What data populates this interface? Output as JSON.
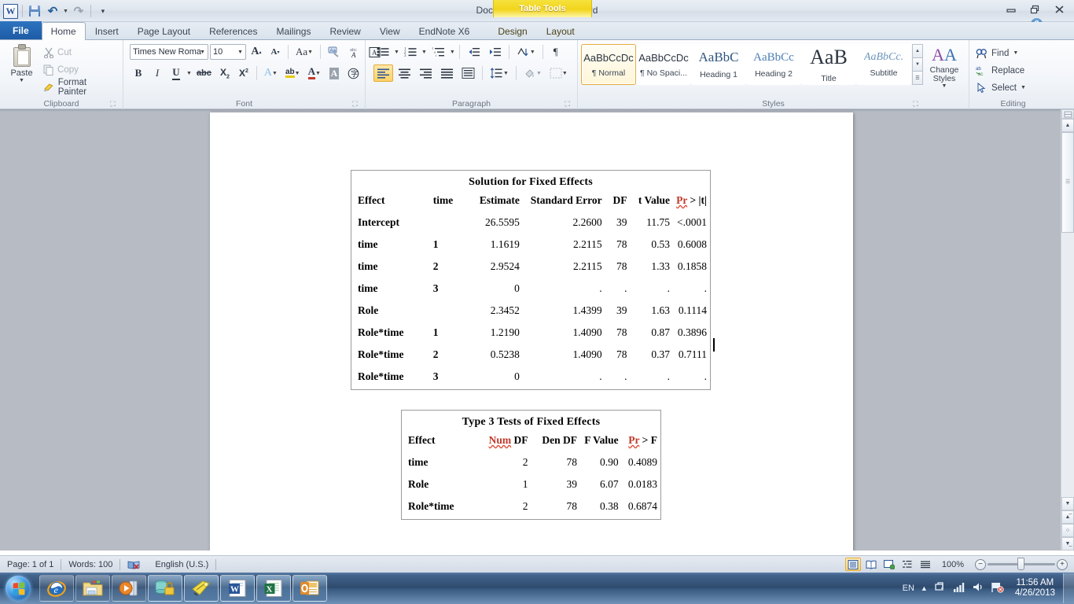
{
  "window": {
    "title": "Document7  -  Microsoft Word",
    "contextual_banner": "Table Tools",
    "minimize": "Minimize",
    "restore": "Restore Down",
    "close": "Close",
    "help": "?",
    "collapse_ribbon": "Minimize the Ribbon"
  },
  "quick_access": {
    "save": "Save",
    "undo": "Undo",
    "redo": "Redo",
    "customize": "Customize Quick Access Toolbar"
  },
  "tabs": [
    {
      "label": "File",
      "type": "file"
    },
    {
      "label": "Home",
      "type": "active"
    },
    {
      "label": "Insert",
      "type": "normal"
    },
    {
      "label": "Page Layout",
      "type": "normal"
    },
    {
      "label": "References",
      "type": "normal"
    },
    {
      "label": "Mailings",
      "type": "normal"
    },
    {
      "label": "Review",
      "type": "normal"
    },
    {
      "label": "View",
      "type": "normal"
    },
    {
      "label": "EndNote X6",
      "type": "normal"
    },
    {
      "label": "Design",
      "type": "contextual"
    },
    {
      "label": "Layout",
      "type": "contextual"
    }
  ],
  "ribbon": {
    "clipboard": {
      "label": "Clipboard",
      "paste": "Paste",
      "cut": "Cut",
      "copy": "Copy",
      "format_painter": "Format Painter",
      "launcher": "Clipboard dialog launcher"
    },
    "font": {
      "label": "Font",
      "font_name": "Times New Roma",
      "font_size": "10",
      "grow_font": "A",
      "shrink_font": "A",
      "change_case": "Aa",
      "clear_formatting": "Clear Formatting",
      "bold": "B",
      "italic": "I",
      "underline": "U",
      "strikethrough": "abc",
      "subscript": "X2",
      "superscript": "X2",
      "text_effects": "A",
      "highlight": "ab",
      "font_color": "A",
      "char_shading": "A",
      "char_border": "A",
      "launcher": "Font dialog launcher"
    },
    "paragraph": {
      "label": "Paragraph",
      "bullets": "Bullets",
      "numbering": "Numbering",
      "multilevel": "Multilevel List",
      "decrease_indent": "Decrease Indent",
      "increase_indent": "Increase Indent",
      "sort": "Sort",
      "show_marks": "¶",
      "align_left": "Align Text Left",
      "align_center": "Center",
      "align_right": "Align Text Right",
      "justify": "Justify",
      "distribute": "Distributed",
      "line_spacing": "Line and Paragraph Spacing",
      "shading": "Shading",
      "borders": "Borders",
      "launcher": "Paragraph dialog launcher"
    },
    "styles": {
      "label": "Styles",
      "launcher": "Styles dialog launcher",
      "items": [
        {
          "preview": "AaBbCcDc",
          "name": "¶ Normal",
          "selected": true
        },
        {
          "preview": "AaBbCcDc",
          "name": "¶ No Spaci...",
          "selected": false
        },
        {
          "preview": "AaBbC",
          "name": "Heading 1",
          "selected": false
        },
        {
          "preview": "AaBbCc",
          "name": "Heading 2",
          "selected": false
        },
        {
          "preview": "AaB",
          "name": "Title",
          "selected": false
        },
        {
          "preview": "AaBbCc.",
          "name": "Subtitle",
          "selected": false
        }
      ],
      "scroll_up": "▲",
      "scroll_down": "▼",
      "more": "▬",
      "change_styles": "Change Styles"
    },
    "editing": {
      "label": "Editing",
      "find": "Find",
      "replace": "Replace",
      "select": "Select"
    }
  },
  "document": {
    "tables": [
      {
        "id": "solution-fixed-effects",
        "caption": "Solution for Fixed Effects",
        "columns": [
          "Effect",
          "time",
          "Estimate",
          "Standard Error",
          "DF",
          "t Value",
          "Pr > |t|"
        ],
        "rows": [
          [
            "Intercept",
            "",
            "26.5595",
            "2.2600",
            "39",
            "11.75",
            "<.0001"
          ],
          [
            "time",
            "1",
            "1.1619",
            "2.2115",
            "78",
            "0.53",
            "0.6008"
          ],
          [
            "time",
            "2",
            "2.9524",
            "2.2115",
            "78",
            "1.33",
            "0.1858"
          ],
          [
            "time",
            "3",
            "0",
            ".",
            ".",
            ".",
            "."
          ],
          [
            "Role",
            "",
            "2.3452",
            "1.4399",
            "39",
            "1.63",
            "0.1114"
          ],
          [
            "Role*time",
            "1",
            "1.2190",
            "1.4090",
            "78",
            "0.87",
            "0.3896"
          ],
          [
            "Role*time",
            "2",
            "0.5238",
            "1.4090",
            "78",
            "0.37",
            "0.7111"
          ],
          [
            "Role*time",
            "3",
            "0",
            ".",
            ".",
            ".",
            "."
          ]
        ]
      },
      {
        "id": "type3-tests-fixed-effects",
        "caption": "Type 3 Tests of Fixed Effects",
        "columns": [
          "Effect",
          "Num DF",
          "Den DF",
          "F Value",
          "Pr > F"
        ],
        "rows": [
          [
            "time",
            "2",
            "78",
            "0.90",
            "0.4089"
          ],
          [
            "Role",
            "1",
            "39",
            "6.07",
            "0.0183"
          ],
          [
            "Role*time",
            "2",
            "78",
            "0.38",
            "0.6874"
          ]
        ]
      }
    ]
  },
  "status_bar": {
    "page": "Page: 1 of 1",
    "words": "Words: 100",
    "proofing": "Proofing errors",
    "language": "English (U.S.)",
    "views": [
      "Print Layout",
      "Full Screen Reading",
      "Web Layout",
      "Outline",
      "Draft"
    ],
    "zoom": "100%",
    "zoom_out": "−",
    "zoom_in": "+"
  },
  "taskbar": {
    "start": "Start",
    "items": [
      {
        "name": "internet-explorer",
        "open": false
      },
      {
        "name": "windows-explorer",
        "open": false
      },
      {
        "name": "windows-media-player",
        "open": false
      },
      {
        "name": "sas-database",
        "open": true
      },
      {
        "name": "endnote",
        "open": true
      },
      {
        "name": "microsoft-word",
        "open": true
      },
      {
        "name": "microsoft-excel",
        "open": true
      },
      {
        "name": "microsoft-outlook",
        "open": true
      }
    ],
    "language": "EN",
    "time": "11:56 AM",
    "date": "4/26/2013"
  },
  "colors": {
    "accent": "#2a5699",
    "contextual": "#f2d41b",
    "selection": "#e3ab3a",
    "taskbar": "#2e4a6d"
  }
}
